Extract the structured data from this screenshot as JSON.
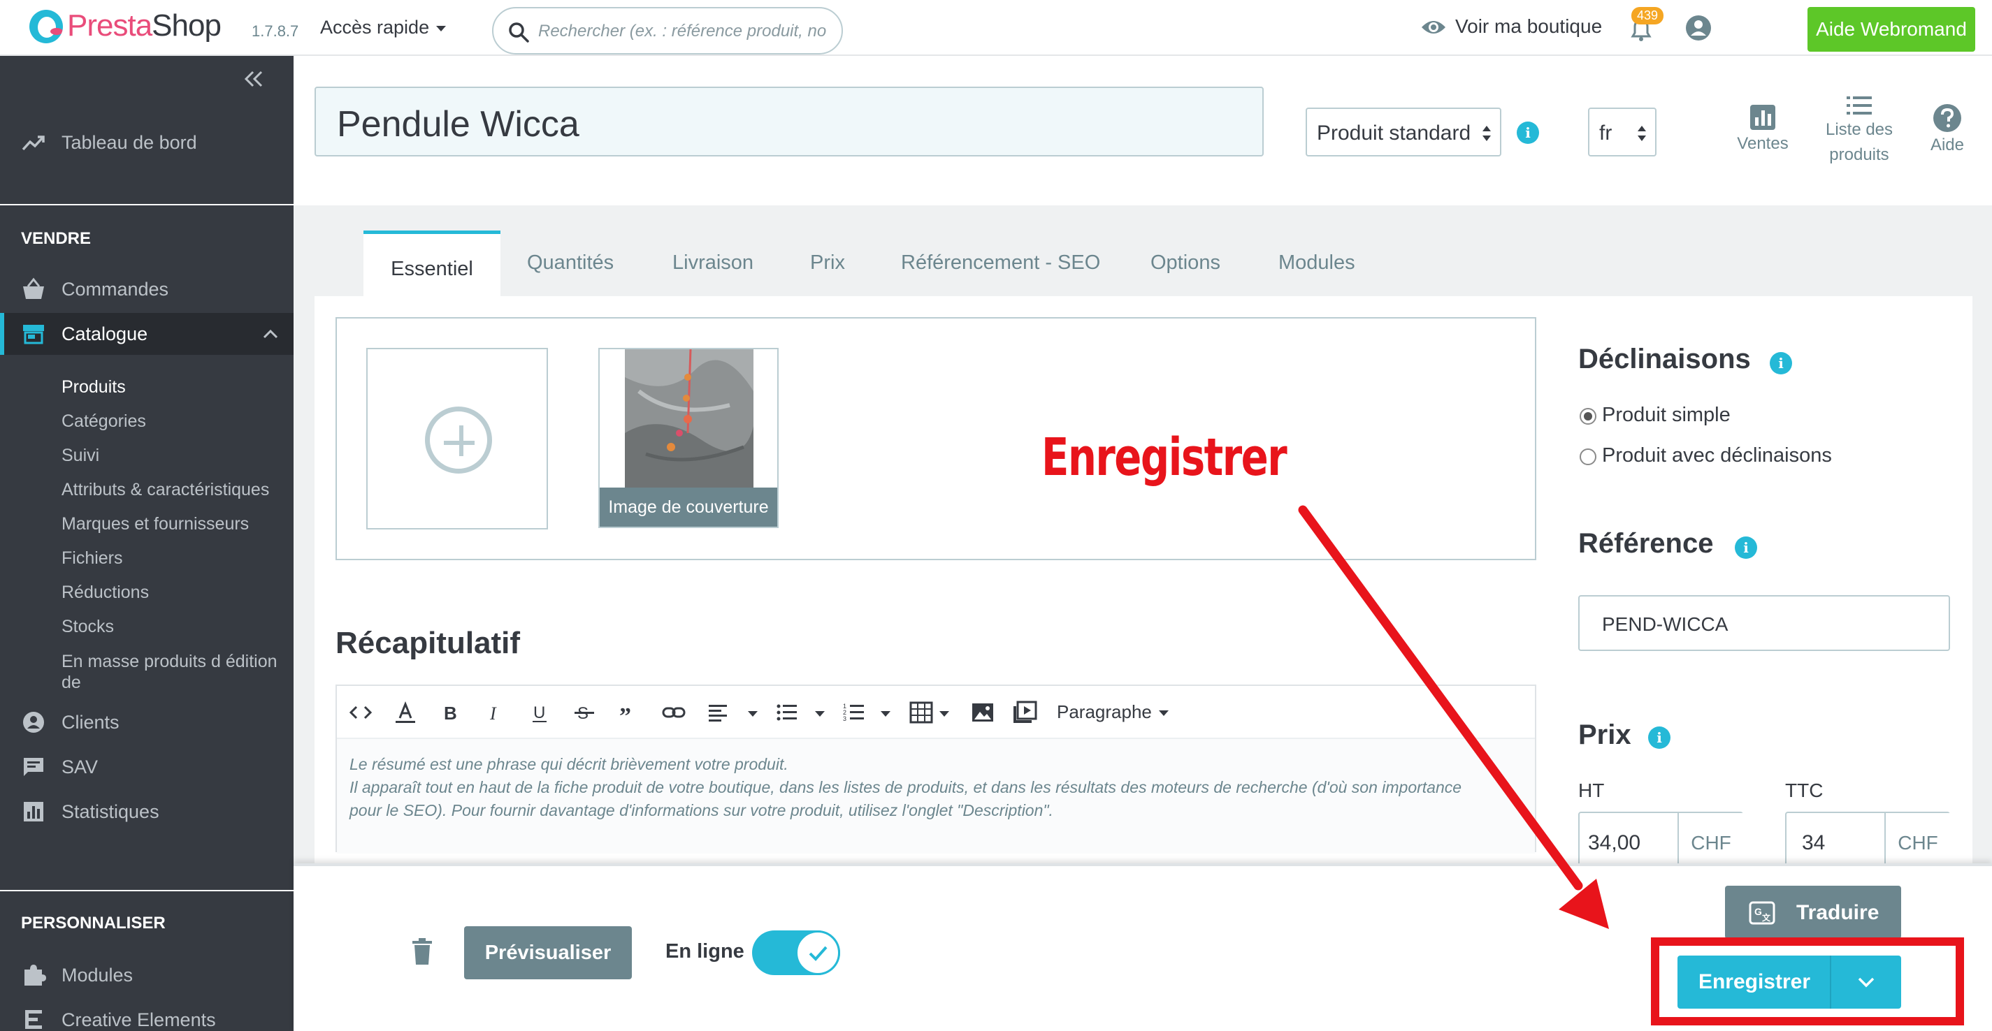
{
  "header": {
    "brand_part1": "Presta",
    "brand_part2": "Shop",
    "version": "1.7.8.7",
    "quick_access": "Accès rapide",
    "search_placeholder": "Rechercher (ex. : référence produit, no",
    "view_shop": "Voir ma boutique",
    "notifications_count": "439",
    "help_button": "Aide Webromand",
    "icons": [
      "prestashop-logo",
      "search-icon",
      "eye-icon",
      "bell-icon",
      "user-icon"
    ]
  },
  "sidebar": {
    "dashboard": "Tableau de bord",
    "section_sell": "VENDRE",
    "orders": "Commandes",
    "catalog": "Catalogue",
    "catalog_sub": [
      "Produits",
      "Catégories",
      "Suivi",
      "Attributs & caractéristiques",
      "Marques et fournisseurs",
      "Fichiers",
      "Réductions",
      "Stocks"
    ],
    "bulk_edit": [
      "En masse produits d édition",
      "de"
    ],
    "customers": "Clients",
    "sav": "SAV",
    "stats": "Statistiques",
    "section_custom": "PERSONNALISER",
    "modules": "Modules",
    "creative": "Creative Elements"
  },
  "product": {
    "name": "Pendule Wicca",
    "type_value": "Produit standard",
    "lang_value": "fr"
  },
  "toolbar": {
    "sales": "Ventes",
    "list_line1": "Liste des",
    "list_line2": "produits",
    "help": "Aide"
  },
  "tabs": [
    "Essentiel",
    "Quantités",
    "Livraison",
    "Prix",
    "Référencement - SEO",
    "Options",
    "Modules"
  ],
  "images": {
    "cover_caption": "Image de couverture"
  },
  "annotation": {
    "label": "Enregistrer",
    "color": "#e8141b"
  },
  "summary": {
    "title": "Récapitulatif",
    "paragraph_style": "Paragraphe",
    "placeholder_line1": "Le résumé est une phrase qui décrit brièvement votre produit.",
    "placeholder_line2": "Il apparaît tout en haut de la fiche produit de votre boutique, dans les listes de produits, et dans les résultats des moteurs de recherche (d'où son importance",
    "placeholder_line3": "pour le SEO). Pour fournir davantage d'informations sur votre produit, utilisez l'onglet \"Description\"."
  },
  "right_panel": {
    "combinations_title": "Déclinaisons",
    "simple_product": "Produit simple",
    "with_combinations": "Produit avec déclinaisons",
    "reference_title": "Référence",
    "reference_value": "PEND-WICCA",
    "price_title": "Prix",
    "ht_label": "HT",
    "ttc_label": "TTC",
    "ht_value": "34,00",
    "ttc_value": "34",
    "currency": "CHF"
  },
  "footer": {
    "preview": "Prévisualiser",
    "online": "En ligne",
    "online_enabled": true,
    "translate": "Traduire",
    "save": "Enregistrer"
  },
  "colors": {
    "accent": "#25b9d7",
    "sidebar": "#363a41",
    "help_green": "#5dc728",
    "annotation_red": "#e8141b"
  }
}
